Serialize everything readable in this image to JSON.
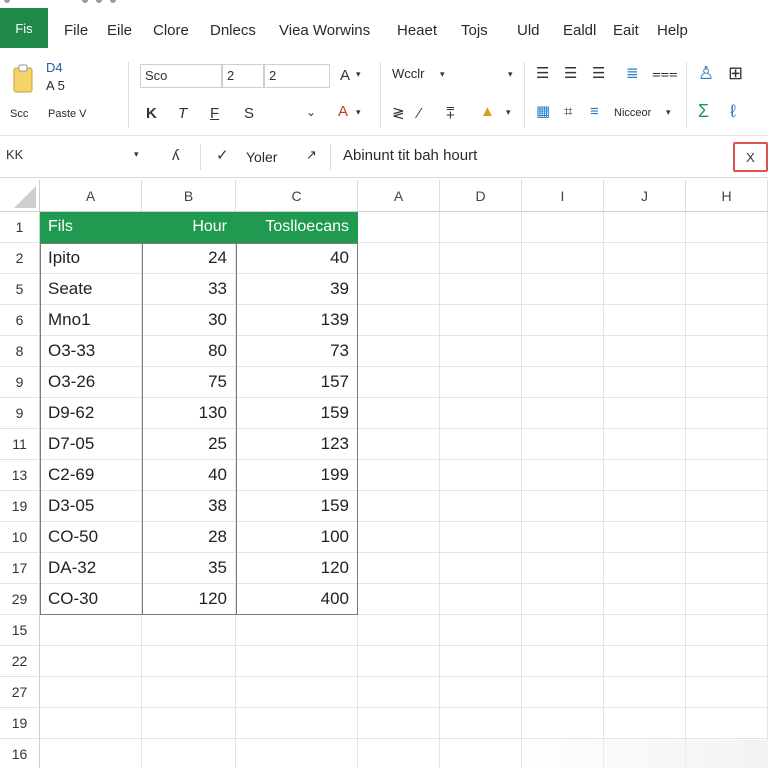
{
  "menubar": {
    "file_tab": "Fis",
    "items": [
      "File",
      "Eile",
      "Clore",
      "Dnlecs",
      "Viea Worwins",
      "Heaet",
      "Tojs",
      "Uld",
      "Ealdl",
      "Eait",
      "Help"
    ]
  },
  "ribbon": {
    "clipboard": {
      "label1": "D4",
      "label2": "A 5",
      "label3": "Scc",
      "paste_label": "Paste V"
    },
    "font": {
      "name": "Sco",
      "size1": "2",
      "size2": "2",
      "bold": "K",
      "italic": "T",
      "underline": "F",
      "strike": "S"
    },
    "alignment": {
      "wrap_label": "Wcclr",
      "merge_label": "Nicceor"
    }
  },
  "formula_bar": {
    "name_box": "KK",
    "function_label": "Yoler",
    "content": "Abinunt tit bah hourt",
    "close_label": "X"
  },
  "columns": [
    "A",
    "B",
    "C",
    "A",
    "D",
    "I",
    "J",
    "H"
  ],
  "rows": [
    {
      "num": "1",
      "a": "Fils",
      "b": "Hour",
      "c": "Toslloecans"
    },
    {
      "num": "2",
      "a": "Ipito",
      "b": "24",
      "c": "40"
    },
    {
      "num": "5",
      "a": "Seate",
      "b": "33",
      "c": "39"
    },
    {
      "num": "6",
      "a": "Mno1",
      "b": "30",
      "c": "139"
    },
    {
      "num": "8",
      "a": "O3-33",
      "b": "80",
      "c": "73"
    },
    {
      "num": "9",
      "a": "O3-26",
      "b": "75",
      "c": "157"
    },
    {
      "num": "9",
      "a": "D9-62",
      "b": "130",
      "c": "159"
    },
    {
      "num": "11",
      "a": "D7-05",
      "b": "25",
      "c": "123"
    },
    {
      "num": "13",
      "a": "C2-69",
      "b": "40",
      "c": "199"
    },
    {
      "num": "19",
      "a": "D3-05",
      "b": "38",
      "c": "159"
    },
    {
      "num": "10",
      "a": "CO-50",
      "b": "28",
      "c": "100"
    },
    {
      "num": "17",
      "a": "DA-32",
      "b": "35",
      "c": "120"
    },
    {
      "num": "29",
      "a": "CO-30",
      "b": "120",
      "c": "400"
    },
    {
      "num": "15",
      "a": "",
      "b": "",
      "c": ""
    },
    {
      "num": "22",
      "a": "",
      "b": "",
      "c": ""
    },
    {
      "num": "27",
      "a": "",
      "b": "",
      "c": ""
    },
    {
      "num": "19",
      "a": "",
      "b": "",
      "c": ""
    },
    {
      "num": "16",
      "a": "",
      "b": "",
      "c": ""
    }
  ],
  "colors": {
    "accent": "#1f9a50",
    "file_tab": "#1f8a48",
    "close_border": "#d9534f"
  }
}
